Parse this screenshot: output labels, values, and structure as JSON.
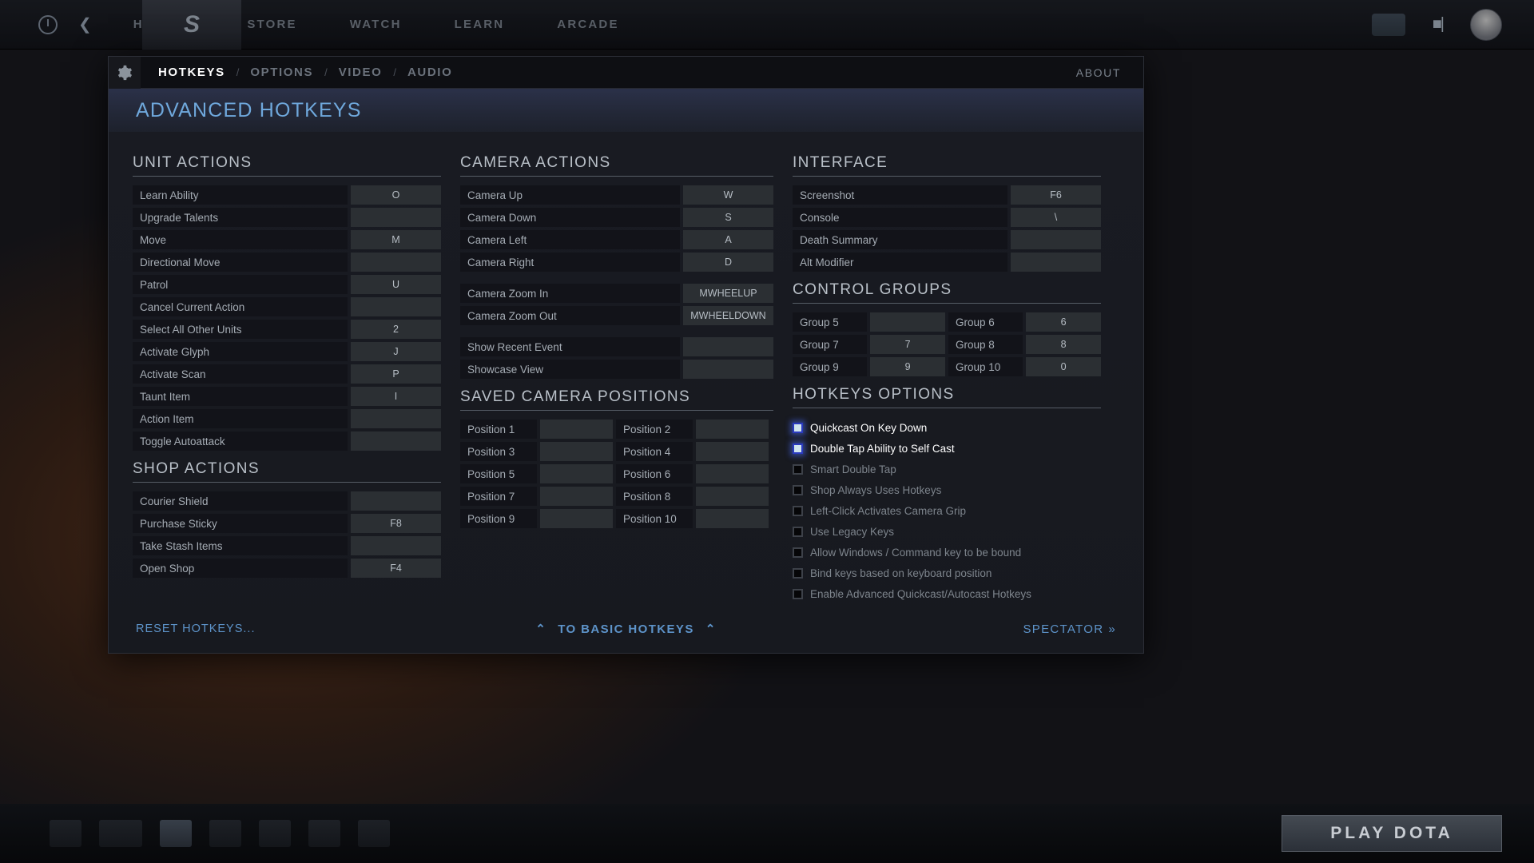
{
  "client": {
    "nav": [
      "HEROES",
      "STORE",
      "WATCH",
      "LEARN",
      "ARCADE"
    ],
    "play_button": "PLAY DOTA",
    "back_icon": "back-arrow-icon",
    "home_icon": "home-circle-icon",
    "logo_icon": "dota-logo-icon",
    "chat_icon": "chat-icon",
    "friends_icon": "friends-icon",
    "avatar_icon": "user-avatar-icon"
  },
  "panel": {
    "gear_icon": "gear-icon",
    "tabs": [
      {
        "label": "HOTKEYS",
        "active": true
      },
      {
        "label": "OPTIONS",
        "active": false
      },
      {
        "label": "VIDEO",
        "active": false
      },
      {
        "label": "AUDIO",
        "active": false
      }
    ],
    "tab_separator": "/",
    "about": "ABOUT",
    "title": "ADVANCED HOTKEYS"
  },
  "unit_actions": {
    "heading": "UNIT ACTIONS",
    "rows": [
      {
        "label": "Learn Ability",
        "key": "O"
      },
      {
        "label": "Upgrade Talents",
        "key": ""
      },
      {
        "label": "Move",
        "key": "M"
      },
      {
        "label": "Directional Move",
        "key": ""
      },
      {
        "label": "Patrol",
        "key": "U"
      },
      {
        "label": "Cancel Current Action",
        "key": ""
      },
      {
        "label": "Select All Other Units",
        "key": "2"
      },
      {
        "label": "Activate Glyph",
        "key": "J"
      },
      {
        "label": "Activate Scan",
        "key": "P"
      },
      {
        "label": "Taunt Item",
        "key": "I"
      },
      {
        "label": "Action Item",
        "key": ""
      },
      {
        "label": "Toggle Autoattack",
        "key": ""
      }
    ]
  },
  "shop_actions": {
    "heading": "SHOP ACTIONS",
    "rows": [
      {
        "label": "Courier Shield",
        "key": ""
      },
      {
        "label": "Purchase Sticky",
        "key": "F8"
      },
      {
        "label": "Take Stash Items",
        "key": ""
      },
      {
        "label": "Open Shop",
        "key": "F4"
      }
    ]
  },
  "camera_actions": {
    "heading": "CAMERA ACTIONS",
    "group1": [
      {
        "label": "Camera Up",
        "key": "W"
      },
      {
        "label": "Camera Down",
        "key": "S"
      },
      {
        "label": "Camera Left",
        "key": "A"
      },
      {
        "label": "Camera Right",
        "key": "D"
      }
    ],
    "group2": [
      {
        "label": "Camera Zoom In",
        "key": "MWHEELUP"
      },
      {
        "label": "Camera Zoom Out",
        "key": "MWHEELDOWN"
      }
    ],
    "group3": [
      {
        "label": "Show Recent Event",
        "key": ""
      },
      {
        "label": "Showcase View",
        "key": ""
      }
    ]
  },
  "saved_camera_positions": {
    "heading": "SAVED CAMERA POSITIONS",
    "rows": [
      [
        {
          "label": "Position 1",
          "key": ""
        },
        {
          "label": "Position 2",
          "key": ""
        }
      ],
      [
        {
          "label": "Position 3",
          "key": ""
        },
        {
          "label": "Position 4",
          "key": ""
        }
      ],
      [
        {
          "label": "Position 5",
          "key": ""
        },
        {
          "label": "Position 6",
          "key": ""
        }
      ],
      [
        {
          "label": "Position 7",
          "key": ""
        },
        {
          "label": "Position 8",
          "key": ""
        }
      ],
      [
        {
          "label": "Position 9",
          "key": ""
        },
        {
          "label": "Position 10",
          "key": ""
        }
      ]
    ]
  },
  "interface": {
    "heading": "INTERFACE",
    "rows": [
      {
        "label": "Screenshot",
        "key": "F6"
      },
      {
        "label": "Console",
        "key": "\\"
      },
      {
        "label": "Death Summary",
        "key": ""
      },
      {
        "label": "Alt Modifier",
        "key": ""
      }
    ]
  },
  "control_groups": {
    "heading": "CONTROL GROUPS",
    "rows": [
      [
        {
          "label": "Group 5",
          "key": ""
        },
        {
          "label": "Group 6",
          "key": "6"
        }
      ],
      [
        {
          "label": "Group 7",
          "key": "7"
        },
        {
          "label": "Group 8",
          "key": "8"
        }
      ],
      [
        {
          "label": "Group 9",
          "key": "9"
        },
        {
          "label": "Group 10",
          "key": "0"
        }
      ]
    ]
  },
  "hotkeys_options": {
    "heading": "HOTKEYS OPTIONS",
    "options": [
      {
        "label": "Quickcast On Key Down",
        "checked": true
      },
      {
        "label": "Double Tap Ability to Self Cast",
        "checked": true
      },
      {
        "label": "Smart Double Tap",
        "checked": false
      },
      {
        "label": "Shop Always Uses Hotkeys",
        "checked": false
      },
      {
        "label": "Left-Click Activates Camera Grip",
        "checked": false
      },
      {
        "label": "Use Legacy Keys",
        "checked": false
      },
      {
        "label": "Allow Windows / Command key to be bound",
        "checked": false
      },
      {
        "label": "Bind keys based on keyboard position",
        "checked": false
      },
      {
        "label": "Enable Advanced Quickcast/Autocast Hotkeys",
        "checked": false
      }
    ]
  },
  "footer": {
    "reset": "RESET HOTKEYS...",
    "basic": "TO BASIC HOTKEYS",
    "chevron_left": "⌃",
    "chevron_right": "⌃",
    "spectator": "SPECTATOR",
    "spectator_chevron": "»"
  },
  "colors": {
    "accent_blue": "#5d93c9",
    "title_blue": "#6fa8dc",
    "checked_fill": "#cfe4ee"
  }
}
